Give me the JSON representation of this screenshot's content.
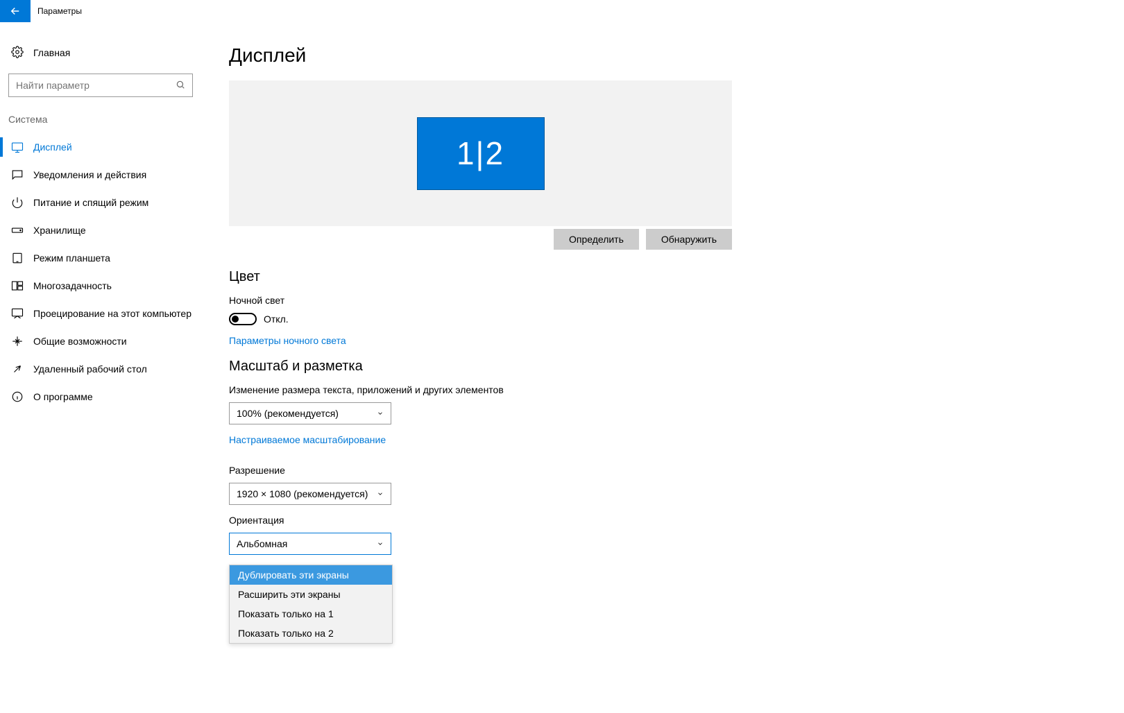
{
  "titlebar": {
    "title": "Параметры"
  },
  "sidebar": {
    "home": "Главная",
    "search_placeholder": "Найти параметр",
    "category": "Система",
    "items": [
      {
        "label": "Дисплей",
        "active": true
      },
      {
        "label": "Уведомления и действия"
      },
      {
        "label": "Питание и спящий режим"
      },
      {
        "label": "Хранилище"
      },
      {
        "label": "Режим планшета"
      },
      {
        "label": "Многозадачность"
      },
      {
        "label": "Проецирование на этот компьютер"
      },
      {
        "label": "Общие возможности"
      },
      {
        "label": "Удаленный рабочий стол"
      },
      {
        "label": "О программе"
      }
    ]
  },
  "main": {
    "title": "Дисплей",
    "monitor_label": "1|2",
    "identify_btn": "Определить",
    "detect_btn": "Обнаружить",
    "color_heading": "Цвет",
    "night_light_label": "Ночной свет",
    "night_light_state": "Откл.",
    "night_light_settings_link": "Параметры ночного света",
    "scale_heading": "Масштаб и разметка",
    "scale_label": "Изменение размера текста, приложений и других элементов",
    "scale_value": "100% (рекомендуется)",
    "custom_scale_link": "Настраиваемое масштабирование",
    "resolution_label": "Разрешение",
    "resolution_value": "1920 × 1080 (рекомендуется)",
    "orientation_label": "Ориентация",
    "orientation_value": "Альбомная",
    "multi_options": [
      "Дублировать эти экраны",
      "Расширить эти экраны",
      "Показать только на 1",
      "Показать только на 2"
    ]
  }
}
